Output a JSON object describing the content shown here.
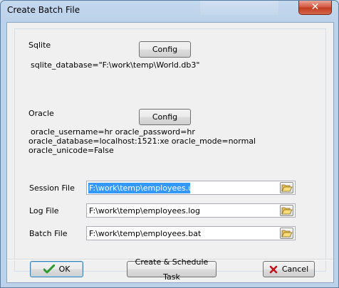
{
  "window": {
    "title": "Create Batch File",
    "close_glyph": "✕"
  },
  "sqlite": {
    "label": "Sqlite",
    "config_label": "Config",
    "info": "sqlite_database=\"F:\\work\\temp\\World.db3\""
  },
  "oracle": {
    "label": "Oracle",
    "config_label": "Config",
    "info_line1": "oracle_username=hr oracle_password=hr",
    "info_line2": "oracle_database=localhost:1521:xe oracle_mode=normal",
    "info_line3": "oracle_unicode=False"
  },
  "files": {
    "session_label": "Session File",
    "session_value": "F:\\work\\temp\\employees.uld",
    "log_label": "Log File",
    "log_value": "F:\\work\\temp\\employees.log",
    "batch_label": "Batch File",
    "batch_value": "F:\\work\\temp\\employees.bat",
    "browse_icon": "folder-open-icon"
  },
  "buttons": {
    "ok_label": "OK",
    "schedule_label": "Create & Schedule Task",
    "cancel_label": "Cancel"
  },
  "colors": {
    "selection": "#3399ff",
    "ok_check": "#2e9a2e",
    "cancel_x": "#c0141a"
  }
}
